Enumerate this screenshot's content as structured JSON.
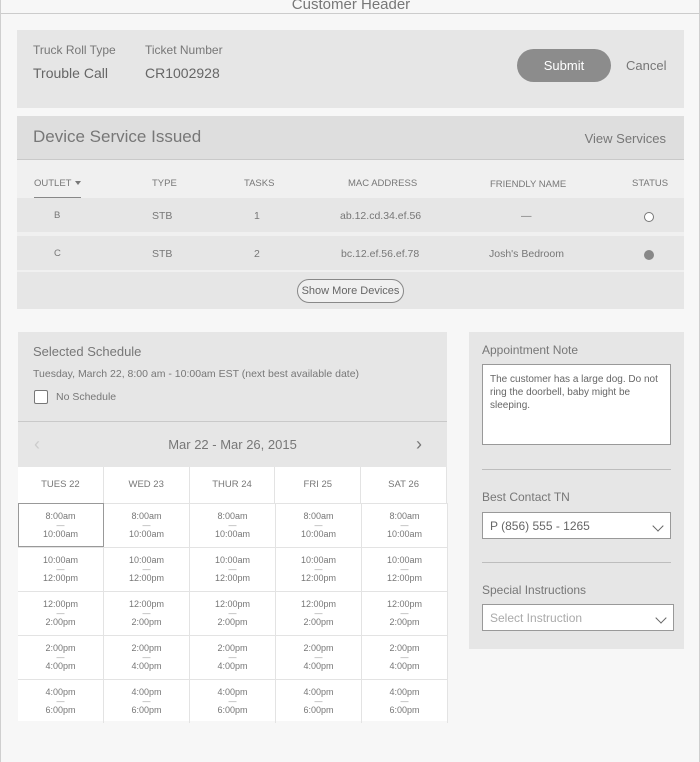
{
  "header": {
    "title": "Customer Header"
  },
  "ticket": {
    "type_label": "Truck Roll Type",
    "type_value": "Trouble Call",
    "number_label": "Ticket Number",
    "number_value": "CR1002928",
    "submit_label": "Submit",
    "cancel_label": "Cancel"
  },
  "devices": {
    "title": "Device Service Issued",
    "view_services": "View Services",
    "columns": [
      "OUTLET",
      "TYPE",
      "TASKS",
      "MAC ADDRESS",
      "FRIENDLY NAME",
      "STATUS"
    ],
    "rows": [
      {
        "outlet": "B",
        "type": "STB",
        "tasks": "1",
        "mac": "ab.12.cd.34.ef.56",
        "friendly": "—",
        "status": "empty"
      },
      {
        "outlet": "C",
        "type": "STB",
        "tasks": "2",
        "mac": "bc.12.ef.56.ef.78",
        "friendly": "Josh's Bedroom",
        "status": "filled"
      }
    ],
    "show_more": "Show More Devices"
  },
  "schedule": {
    "title": "Selected Schedule",
    "selected_text": "Tuesday, March 22, 8:00 am - 10:00am EST (next best available date)",
    "no_schedule": "No Schedule",
    "week_range": "Mar 22 - Mar 26, 2015",
    "days": [
      "TUES 22",
      "WED 23",
      "THUR 24",
      "FRI 25",
      "SAT 26"
    ],
    "slots": [
      {
        "start": "8:00am",
        "end": "10:00am"
      },
      {
        "start": "10:00am",
        "end": "12:00pm"
      },
      {
        "start": "12:00pm",
        "end": "2:00pm"
      },
      {
        "start": "2:00pm",
        "end": "4:00pm"
      },
      {
        "start": "4:00pm",
        "end": "6:00pm"
      }
    ],
    "selected_slot": {
      "day": 0,
      "slot": 0
    }
  },
  "appointment": {
    "note_label": "Appointment Note",
    "note_text": "The customer has a large dog. Do not ring the doorbell, baby might be sleeping.",
    "contact_label": "Best Contact TN",
    "contact_value": "P (856) 555 - 1265",
    "instructions_label": "Special Instructions",
    "instructions_placeholder": "Select Instruction"
  }
}
